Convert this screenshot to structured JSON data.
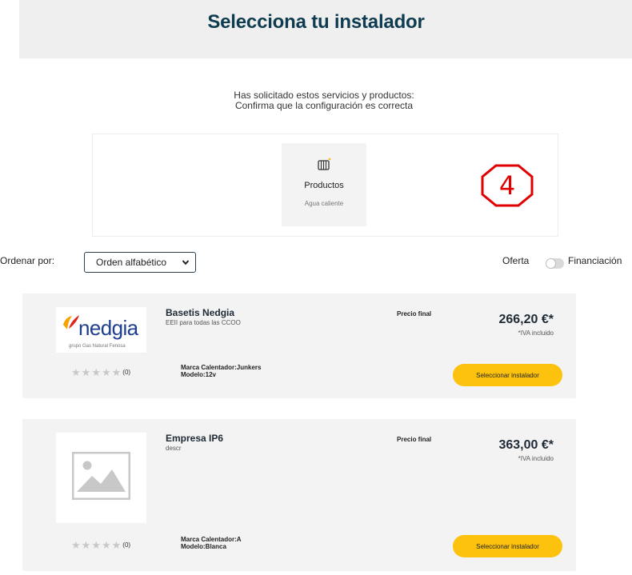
{
  "header": {
    "title": "Selecciona tu instalador"
  },
  "intro": {
    "line1": "Has solicitado estos servicios y productos:",
    "line2": "Confirma que la configuración es correcta"
  },
  "services": {
    "product": {
      "icon": "radiator-icon",
      "title": "Productos",
      "subtitle": "Agua caliente"
    }
  },
  "annotation": {
    "step": "4",
    "color": "#e10000"
  },
  "filters": {
    "sort_label": "Ordenar por:",
    "sort_selected": "Orden alfabético",
    "offer_label": "Oferta",
    "financing_label": "Financiación",
    "financing_enabled": false
  },
  "installers": [
    {
      "name": "Basetis Nedgia",
      "description": "EEII para todas las CCOO",
      "logo": {
        "type": "nedgia-logo",
        "wordmark": "nedgia",
        "tagline": "grupo Gas Natural Fenosa"
      },
      "price_label": "Precio final",
      "price": "266,20 €*",
      "tax_note": "*IVA incluido",
      "rating_stars": 0,
      "rating_count": "(0)",
      "attribute1": "Marca Calentador:Junkers",
      "attribute2": "Modelo:12v",
      "button_label": "Seleccionar instalador"
    },
    {
      "name": "Empresa IP6",
      "description": "descr",
      "logo": {
        "type": "image-placeholder-icon"
      },
      "price_label": "Precio final",
      "price": "363,00 €*",
      "tax_note": "*IVA incluido",
      "rating_stars": 0,
      "rating_count": "(0)",
      "attribute1": "Marca Calentador:A",
      "attribute2": "Modelo:Blanca",
      "button_label": "Seleccionar instalador"
    }
  ],
  "colors": {
    "title": "#0e3b4f",
    "button": "#fcc20e",
    "card_bg": "#f3f3f3",
    "brand_blue": "#1d3f8f"
  }
}
